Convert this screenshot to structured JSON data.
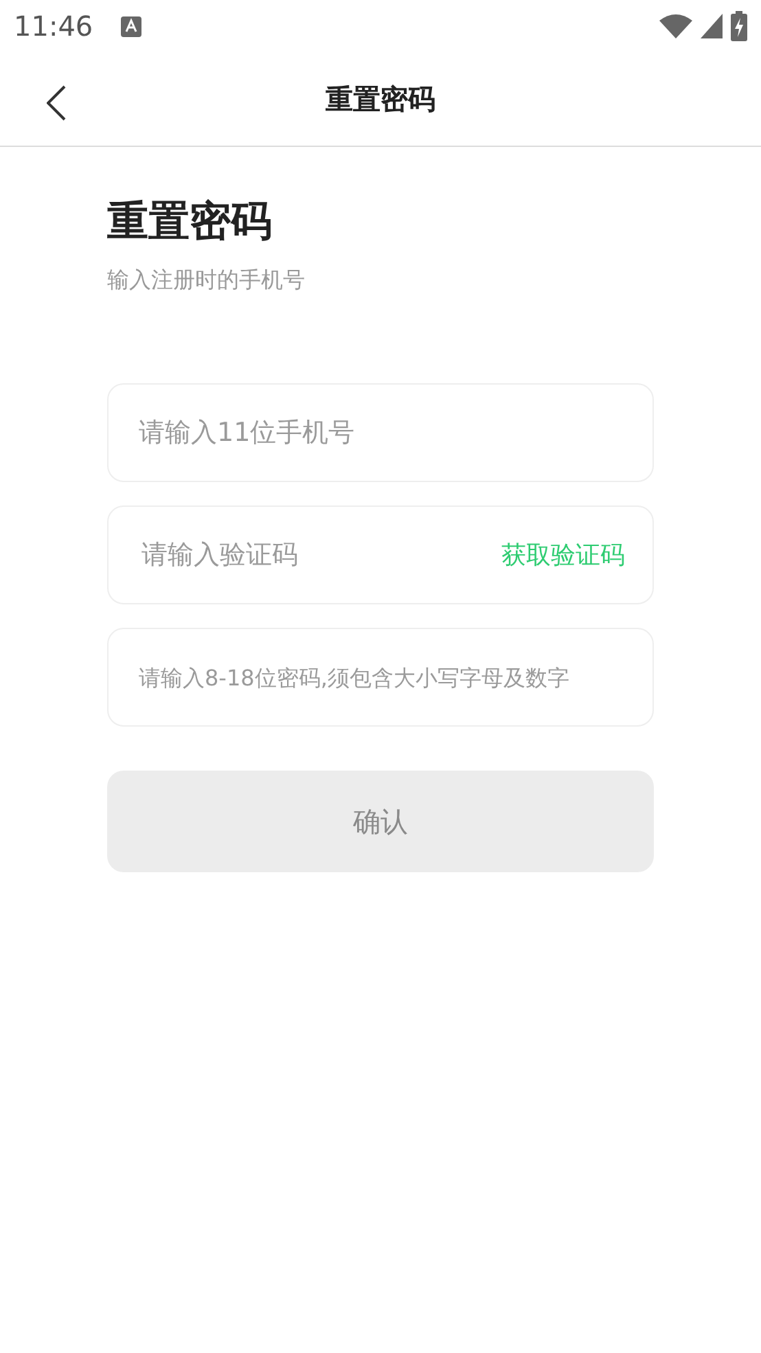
{
  "status_bar": {
    "time": "11:46"
  },
  "nav_bar": {
    "title": "重置密码"
  },
  "heading": {
    "title": "重置密码",
    "subtitle": "输入注册时的手机号"
  },
  "fields": [
    {
      "kind": "plain",
      "placeholder": "请输入11位手机号"
    },
    {
      "kind": "code",
      "placeholder": "请输入验证码",
      "action": "获取验证码"
    },
    {
      "kind": "plain",
      "placeholder": "请输入8-18位密码,须包含大小写字母及数字"
    }
  ],
  "confirm_button": {
    "label": "确认",
    "disabled": true
  }
}
